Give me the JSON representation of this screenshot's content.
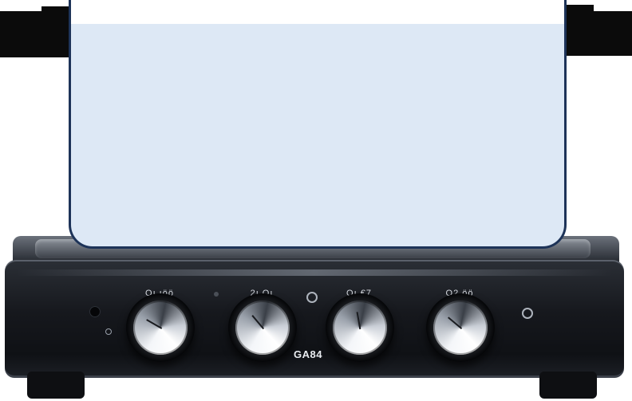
{
  "scene": {
    "subject": "induction-cooktop-product-photo",
    "model_label": "GA84",
    "knob_labels": [
      "Oı ıöö",
      "2ı Oı",
      "Oı €7",
      "O2 öö"
    ]
  },
  "colors": {
    "panel_fill": "#dde8f5",
    "panel_border": "#1d3358",
    "body": "#16181d",
    "knob_metal": "#c9ced6"
  }
}
